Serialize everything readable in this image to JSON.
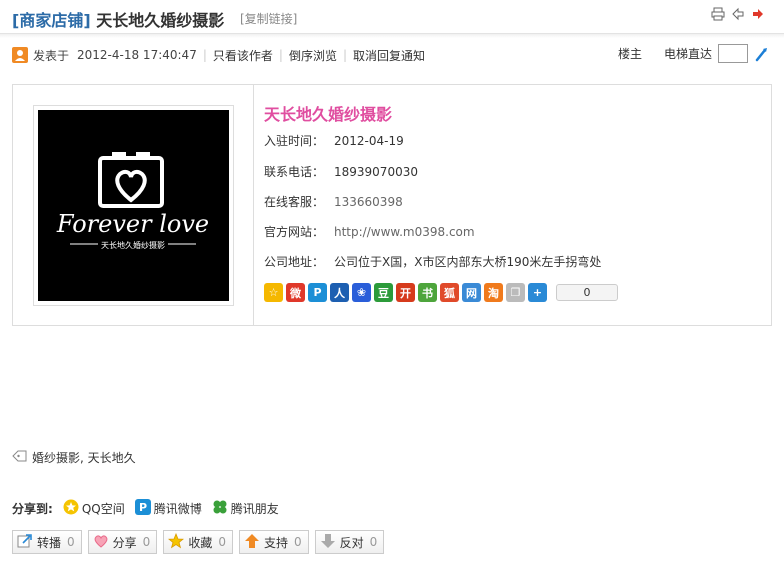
{
  "thread": {
    "category": "[商家店铺]",
    "title": "天长地久婚纱摄影",
    "copy_link": "[复制链接]"
  },
  "meta": {
    "posted_label": "发表于",
    "posted_time": "2012-4-18 17:40:47",
    "author_only": "只看该作者",
    "reverse_view": "倒序浏览",
    "cancel_notify": "取消回复通知",
    "floor_owner": "楼主",
    "elevator": "电梯直达"
  },
  "store": {
    "name": "天长地久婚纱摄影",
    "logo_text": "Forever love",
    "logo_subtext": "天长地久婚纱摄影",
    "rows": [
      {
        "label": "入驻时间：",
        "value": "2012-04-19"
      },
      {
        "label": "联系电话：",
        "value": "18939070030"
      },
      {
        "label": "在线客服：",
        "value": "133660398"
      },
      {
        "label": "官方网站：",
        "value": "http://www.m0398.com"
      },
      {
        "label": "公司地址：",
        "value": "公司位于X国，X市区内部东大桥190米左手拐弯处"
      }
    ],
    "share_count": "0"
  },
  "share_icons": [
    {
      "name": "qzone-icon",
      "glyph": "☆",
      "color": "#f5b800"
    },
    {
      "name": "weibo-icon",
      "glyph": "微",
      "color": "#e0382a"
    },
    {
      "name": "tqq-icon",
      "glyph": "P",
      "color": "#1c8fd6"
    },
    {
      "name": "renren-icon",
      "glyph": "人",
      "color": "#1d5fb1"
    },
    {
      "name": "baidu-icon",
      "glyph": "❀",
      "color": "#2a5ed9"
    },
    {
      "name": "douban-icon",
      "glyph": "豆",
      "color": "#2c9b3a"
    },
    {
      "name": "kaixin-icon",
      "glyph": "开",
      "color": "#d63b1c"
    },
    {
      "name": "bookmark-icon",
      "glyph": "书",
      "color": "#4ea53c"
    },
    {
      "name": "sohu-icon",
      "glyph": "狐",
      "color": "#e04a2a"
    },
    {
      "name": "netease-icon",
      "glyph": "网",
      "color": "#3a8ad6"
    },
    {
      "name": "taobao-icon",
      "glyph": "淘",
      "color": "#f07a1c"
    },
    {
      "name": "copy-icon",
      "glyph": "❐",
      "color": "#bbbbbb"
    },
    {
      "name": "more-icon",
      "glyph": "+",
      "color": "#2a8ad6"
    }
  ],
  "tags": {
    "text": "婚纱摄影, 天长地久"
  },
  "share_to": {
    "label": "分享到:",
    "items": [
      "QQ空间",
      "腾讯微博",
      "腾讯朋友"
    ]
  },
  "actions": [
    {
      "name": "forward-button",
      "label": "转播",
      "count": "0"
    },
    {
      "name": "share-button",
      "label": "分享",
      "count": "0"
    },
    {
      "name": "favorite-button",
      "label": "收藏",
      "count": "0"
    },
    {
      "name": "support-button",
      "label": "支持",
      "count": "0"
    },
    {
      "name": "oppose-button",
      "label": "反对",
      "count": "0"
    }
  ],
  "colors": {
    "store_name": "#e04ea0",
    "category": "#2c6ba7"
  }
}
